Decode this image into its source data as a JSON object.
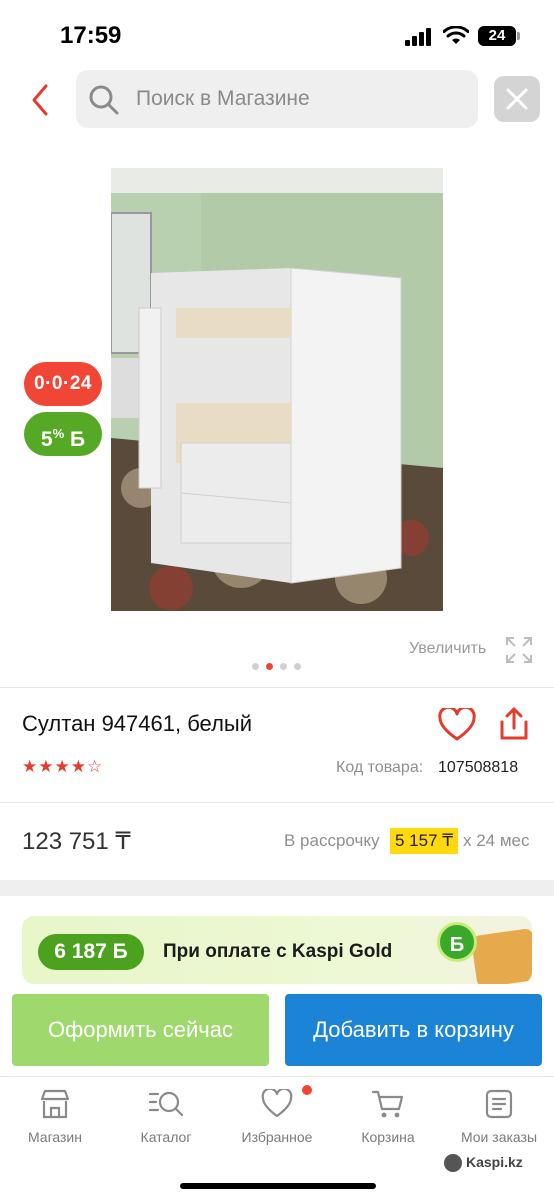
{
  "status_bar": {
    "time": "17:59",
    "battery": "24"
  },
  "search": {
    "placeholder": "Поиск в Магазине"
  },
  "badges": {
    "installment": "0·0·24",
    "bonus_value": "5",
    "bonus_suffix": "%",
    "bonus_currency": "Б"
  },
  "gallery": {
    "zoom_label": "Увеличить",
    "dots_total": 4,
    "active_dot": 1
  },
  "product": {
    "title": "Султан 947461, белый",
    "rating": 4,
    "rating_max": 5,
    "code_label": "Код товара:",
    "code_value": "107508818",
    "price": "123 751 ₸",
    "installment_label": "В рассрочку",
    "installment_amount": "5 157 ₸",
    "installment_term": "x 24 мес"
  },
  "kaspi_gold": {
    "bonus": "6 187 Б",
    "text": "При оплате с Kaspi Gold",
    "coin_letter": "Б"
  },
  "actions": {
    "checkout": "Оформить сейчас",
    "add_to_cart": "Добавить в корзину"
  },
  "tabbar": {
    "items": [
      {
        "label": "Магазин",
        "icon": "store-icon"
      },
      {
        "label": "Каталог",
        "icon": "catalog-search-icon"
      },
      {
        "label": "Избранное",
        "icon": "heart-icon"
      },
      {
        "label": "Корзина",
        "icon": "cart-icon"
      },
      {
        "label": "Мои заказы",
        "icon": "orders-icon"
      }
    ]
  },
  "watermark": "Kaspi.kz",
  "colors": {
    "accent_red": "#f14635",
    "bonus_green": "#56a925",
    "checkout_green": "#9fd86d",
    "cart_blue": "#1b84d6",
    "installment_yellow": "#ffd80d"
  }
}
